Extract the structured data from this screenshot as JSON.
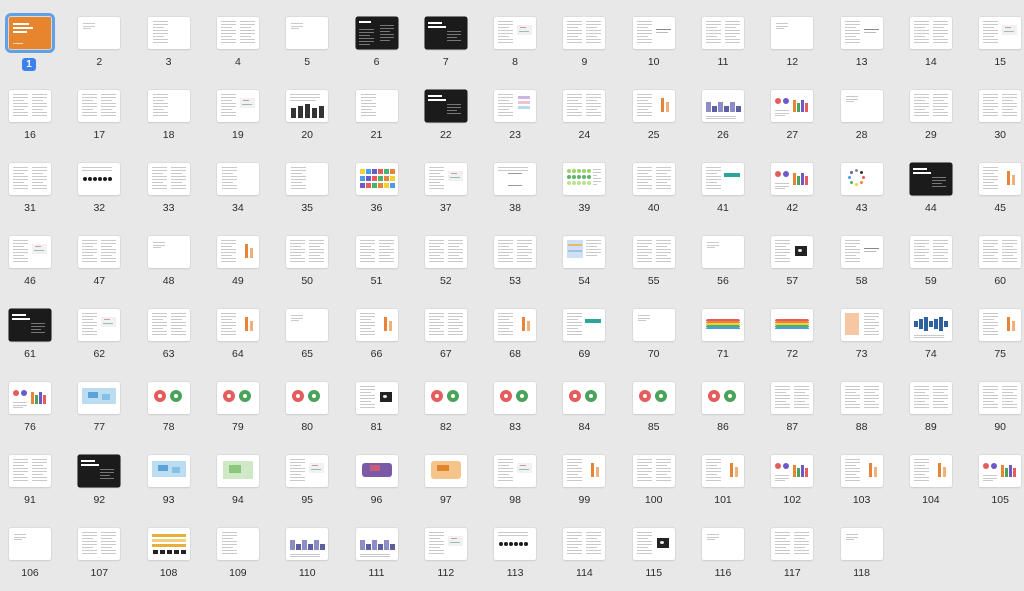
{
  "selected_page": "1",
  "pages": [
    {
      "n": "1",
      "style": "cover"
    },
    {
      "n": "2",
      "style": "sparse"
    },
    {
      "n": "3",
      "style": "text1"
    },
    {
      "n": "4",
      "style": "text2"
    },
    {
      "n": "5",
      "style": "sparse"
    },
    {
      "n": "6",
      "style": "dark-contents"
    },
    {
      "n": "7",
      "style": "dark-title"
    },
    {
      "n": "8",
      "style": "text-fig"
    },
    {
      "n": "9",
      "style": "text2"
    },
    {
      "n": "10",
      "style": "text-line"
    },
    {
      "n": "11",
      "style": "text2"
    },
    {
      "n": "12",
      "style": "sparse"
    },
    {
      "n": "13",
      "style": "text-line"
    },
    {
      "n": "14",
      "style": "text2"
    },
    {
      "n": "15",
      "style": "text-fig"
    },
    {
      "n": "16",
      "style": "text2"
    },
    {
      "n": "17",
      "style": "text2"
    },
    {
      "n": "18",
      "style": "text1"
    },
    {
      "n": "19",
      "style": "text-fig"
    },
    {
      "n": "20",
      "style": "bars-dark"
    },
    {
      "n": "21",
      "style": "text1"
    },
    {
      "n": "22",
      "style": "dark-title"
    },
    {
      "n": "23",
      "style": "text-color"
    },
    {
      "n": "24",
      "style": "text2"
    },
    {
      "n": "25",
      "style": "text-orange"
    },
    {
      "n": "26",
      "style": "chart-purple"
    },
    {
      "n": "27",
      "style": "chart-multi"
    },
    {
      "n": "28",
      "style": "sparse"
    },
    {
      "n": "29",
      "style": "text2"
    },
    {
      "n": "30",
      "style": "text2"
    },
    {
      "n": "31",
      "style": "text2"
    },
    {
      "n": "32",
      "style": "dots"
    },
    {
      "n": "33",
      "style": "text2"
    },
    {
      "n": "34",
      "style": "text1"
    },
    {
      "n": "35",
      "style": "text1"
    },
    {
      "n": "36",
      "style": "swatches"
    },
    {
      "n": "37",
      "style": "text-fig"
    },
    {
      "n": "38",
      "style": "triangle"
    },
    {
      "n": "39",
      "style": "swatches-green"
    },
    {
      "n": "40",
      "style": "text2"
    },
    {
      "n": "41",
      "style": "text-teal"
    },
    {
      "n": "42",
      "style": "chart-multi"
    },
    {
      "n": "43",
      "style": "circle"
    },
    {
      "n": "44",
      "style": "dark-title"
    },
    {
      "n": "45",
      "style": "text-orange"
    },
    {
      "n": "46",
      "style": "text-fig"
    },
    {
      "n": "47",
      "style": "text2"
    },
    {
      "n": "48",
      "style": "sparse"
    },
    {
      "n": "49",
      "style": "text-orange"
    },
    {
      "n": "50",
      "style": "text2"
    },
    {
      "n": "51",
      "style": "text2"
    },
    {
      "n": "52",
      "style": "text2"
    },
    {
      "n": "53",
      "style": "text2"
    },
    {
      "n": "54",
      "style": "text-blue"
    },
    {
      "n": "55",
      "style": "text2"
    },
    {
      "n": "56",
      "style": "sparse"
    },
    {
      "n": "57",
      "style": "text-photo"
    },
    {
      "n": "58",
      "style": "text-line"
    },
    {
      "n": "59",
      "style": "text2"
    },
    {
      "n": "60",
      "style": "text2"
    },
    {
      "n": "61",
      "style": "dark-title"
    },
    {
      "n": "62",
      "style": "text-fig"
    },
    {
      "n": "63",
      "style": "text2"
    },
    {
      "n": "64",
      "style": "text-orange"
    },
    {
      "n": "65",
      "style": "sparse"
    },
    {
      "n": "66",
      "style": "text-orange"
    },
    {
      "n": "67",
      "style": "text2"
    },
    {
      "n": "68",
      "style": "text-orange"
    },
    {
      "n": "69",
      "style": "text-teal"
    },
    {
      "n": "70",
      "style": "sparse"
    },
    {
      "n": "71",
      "style": "rainbow"
    },
    {
      "n": "72",
      "style": "rainbow"
    },
    {
      "n": "73",
      "style": "text-peach"
    },
    {
      "n": "74",
      "style": "wave-blue"
    },
    {
      "n": "75",
      "style": "text-orange"
    },
    {
      "n": "76",
      "style": "chart-multi"
    },
    {
      "n": "77",
      "style": "map-blue"
    },
    {
      "n": "78",
      "style": "pies"
    },
    {
      "n": "79",
      "style": "pies"
    },
    {
      "n": "80",
      "style": "pies"
    },
    {
      "n": "81",
      "style": "text-photo"
    },
    {
      "n": "82",
      "style": "pies"
    },
    {
      "n": "83",
      "style": "pies"
    },
    {
      "n": "84",
      "style": "pies"
    },
    {
      "n": "85",
      "style": "pies"
    },
    {
      "n": "86",
      "style": "pies"
    },
    {
      "n": "87",
      "style": "text2"
    },
    {
      "n": "88",
      "style": "text2"
    },
    {
      "n": "89",
      "style": "text2"
    },
    {
      "n": "90",
      "style": "text2"
    },
    {
      "n": "91",
      "style": "text2"
    },
    {
      "n": "92",
      "style": "dark-title"
    },
    {
      "n": "93",
      "style": "map-blue"
    },
    {
      "n": "94",
      "style": "map-green"
    },
    {
      "n": "95",
      "style": "text-fig"
    },
    {
      "n": "96",
      "style": "map-us"
    },
    {
      "n": "97",
      "style": "map-orange"
    },
    {
      "n": "98",
      "style": "text-fig"
    },
    {
      "n": "99",
      "style": "text-orange"
    },
    {
      "n": "100",
      "style": "text2"
    },
    {
      "n": "101",
      "style": "text-orange"
    },
    {
      "n": "102",
      "style": "chart-multi"
    },
    {
      "n": "103",
      "style": "text-orange"
    },
    {
      "n": "104",
      "style": "text-orange"
    },
    {
      "n": "105",
      "style": "chart-multi"
    },
    {
      "n": "106",
      "style": "sparse"
    },
    {
      "n": "107",
      "style": "text2"
    },
    {
      "n": "108",
      "style": "table"
    },
    {
      "n": "109",
      "style": "text1"
    },
    {
      "n": "110",
      "style": "chart-purple"
    },
    {
      "n": "111",
      "style": "chart-purple"
    },
    {
      "n": "112",
      "style": "text-fig"
    },
    {
      "n": "113",
      "style": "dots"
    },
    {
      "n": "114",
      "style": "text2"
    },
    {
      "n": "115",
      "style": "text-photo"
    },
    {
      "n": "116",
      "style": "sparse"
    },
    {
      "n": "117",
      "style": "text2"
    },
    {
      "n": "118",
      "style": "sparse"
    }
  ],
  "colors": {
    "background": "#e8e8e8",
    "selection_outline": "#5fa0e8",
    "selection_badge": "#3b82f0",
    "cover": "#e7852e",
    "dark_page": "#1b1b1b"
  }
}
